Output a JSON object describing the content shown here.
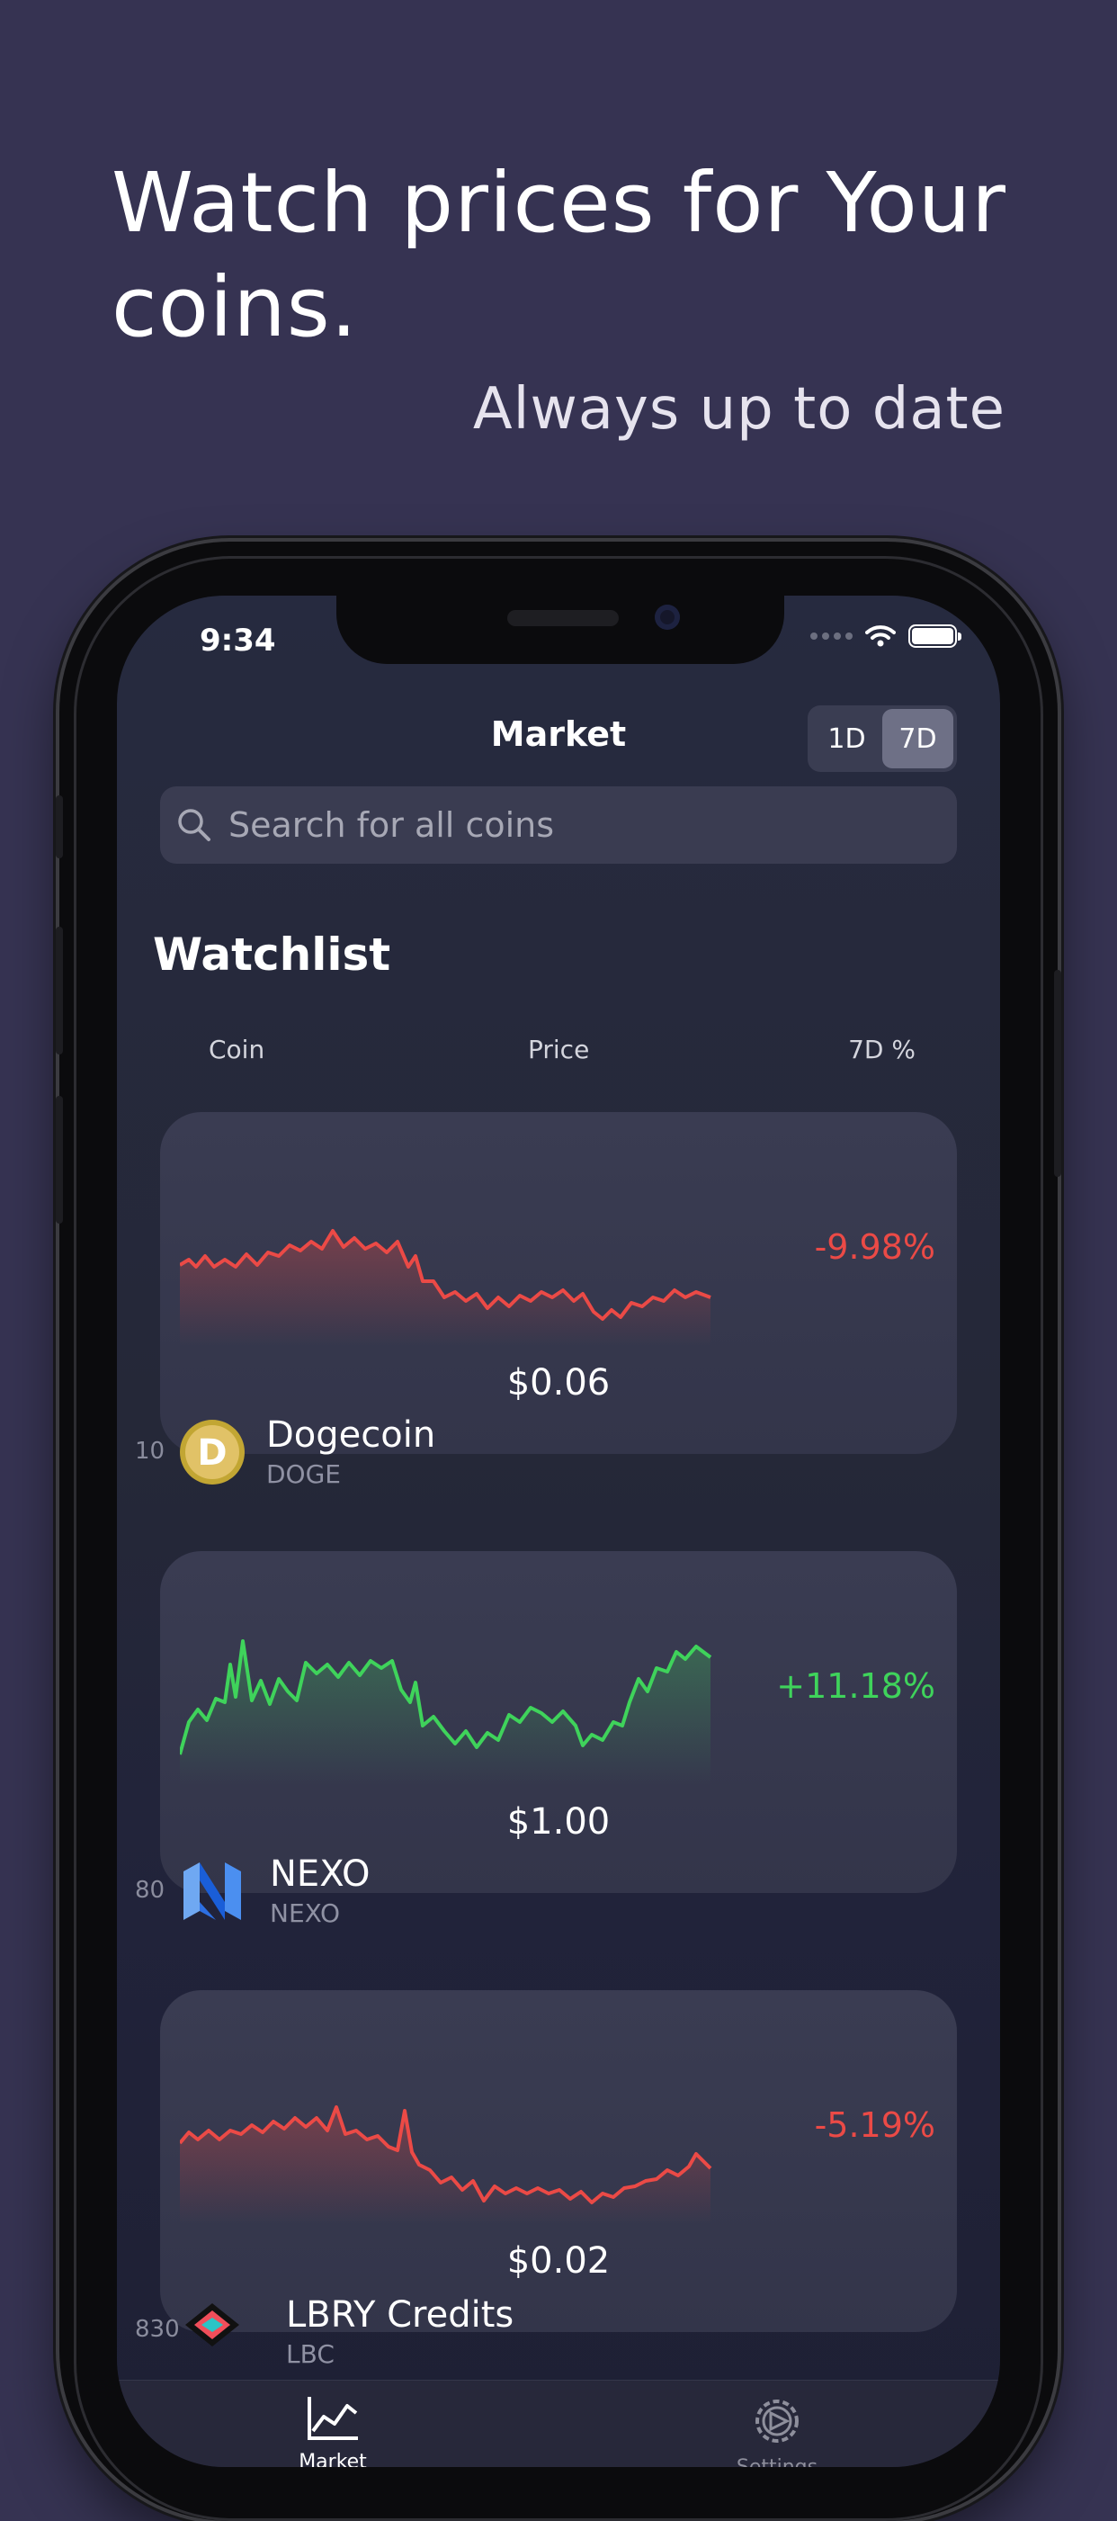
{
  "promo": {
    "headline": "Watch prices for Your coins.",
    "subline": "Always up to date"
  },
  "status_bar": {
    "time": "9:34"
  },
  "nav": {
    "title": "Market",
    "segments": [
      {
        "label": "1D",
        "active": false
      },
      {
        "label": "7D",
        "active": true
      }
    ]
  },
  "search": {
    "placeholder": "Search for all coins",
    "value": ""
  },
  "watchlist": {
    "title": "Watchlist",
    "columns": {
      "coin": "Coin",
      "price": "Price",
      "change": "7D %"
    },
    "items": [
      {
        "rank": "10",
        "name": "Dogecoin",
        "symbol": "DOGE",
        "price": "$0.06",
        "change": "-9.98%",
        "trend": "down",
        "logo": "dogecoin-logo"
      },
      {
        "rank": "80",
        "name": "NEXO",
        "symbol": "NEXO",
        "price": "$1.00",
        "change": "+11.18%",
        "trend": "up",
        "logo": "nexo-logo"
      },
      {
        "rank": "830",
        "name": "LBRY Credits",
        "symbol": "LBC",
        "price": "$0.02",
        "change": "-5.19%",
        "trend": "down",
        "logo": "lbry-logo"
      }
    ]
  },
  "tabbar": {
    "items": [
      {
        "label": "Market",
        "icon": "chart-icon",
        "active": true
      },
      {
        "label": "Settings",
        "icon": "gear-icon",
        "active": false
      }
    ]
  },
  "colors": {
    "background": "#363352",
    "down": "#eb4a46",
    "up": "#3fd35b",
    "card": "#3a3c52"
  }
}
